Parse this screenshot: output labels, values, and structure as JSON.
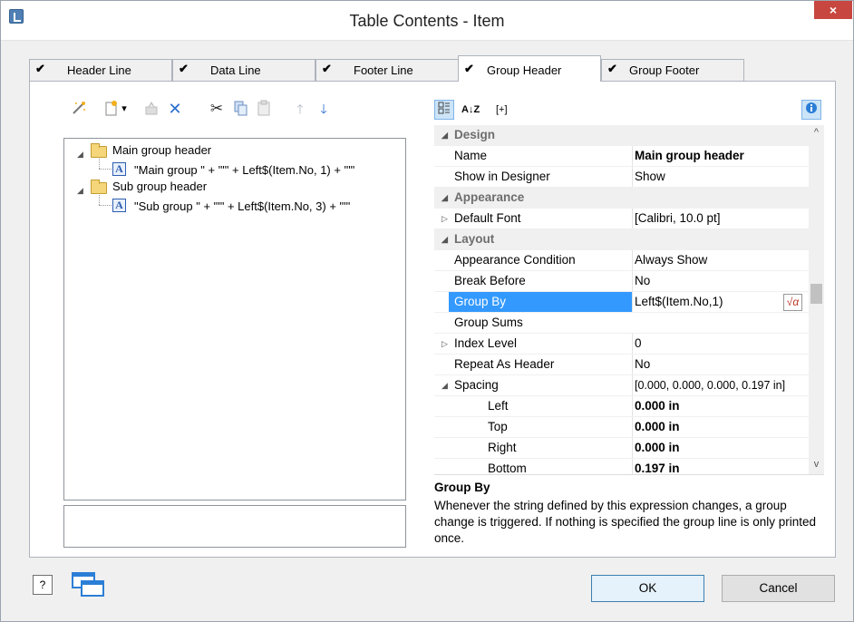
{
  "window": {
    "title": "Table Contents - Item",
    "close_label": "×"
  },
  "tabs": [
    {
      "label": "Header Line",
      "checked": "✔"
    },
    {
      "label": "Data Line",
      "checked": "✔"
    },
    {
      "label": "Footer Line",
      "checked": "✔"
    },
    {
      "label": "Group Header",
      "checked": "✔"
    },
    {
      "label": "Group Footer",
      "checked": "✔"
    }
  ],
  "left_toolbar": {
    "icons": [
      "wand-icon",
      "new-item-icon",
      "dropdown-arrow-icon",
      "properties-icon",
      "delete-icon",
      "cut-icon",
      "copy-icon",
      "paste-icon",
      "move-up-icon",
      "move-down-icon"
    ],
    "delete_glyph": "✕",
    "cut_glyph": "✂",
    "up_glyph": "🡑",
    "down_glyph": "🡓",
    "dropdown_glyph": "▾"
  },
  "tree": {
    "nodes": [
      {
        "label": "Main group header",
        "child": "\"Main group \" + \"'\" + Left$(Item.No, 1) + \"'\""
      },
      {
        "label": "Sub group header",
        "child": "\"Sub group \" + \"'\" + Left$(Item.No, 3) + \"'\""
      }
    ]
  },
  "right_toolbar": {
    "categorized_icon": "categorized-icon",
    "sort_icon": "sort-az-icon",
    "sort_label": "A↓Z",
    "expand_label": "[+]",
    "info_icon": "info-icon"
  },
  "properties": {
    "design_label": "Design",
    "name_label": "Name",
    "name_value": "Main group header",
    "show_in_designer_label": "Show in Designer",
    "show_in_designer_value": "Show",
    "appearance_label": "Appearance",
    "default_font_label": "Default Font",
    "default_font_value": "[Calibri, 10.0 pt]",
    "layout_label": "Layout",
    "appearance_condition_label": "Appearance Condition",
    "appearance_condition_value": "Always Show",
    "break_before_label": "Break Before",
    "break_before_value": "No",
    "group_by_label": "Group By",
    "group_by_value": "Left$(Item.No,1)",
    "group_sums_label": "Group Sums",
    "group_sums_value": "",
    "index_level_label": "Index Level",
    "index_level_value": "0",
    "repeat_as_header_label": "Repeat As Header",
    "repeat_as_header_value": "No",
    "spacing_label": "Spacing",
    "spacing_value": "[0.000, 0.000, 0.000, 0.197 in]",
    "left_label": "Left",
    "left_value": "0.000 in",
    "top_label": "Top",
    "top_value": "0.000 in",
    "right_label": "Right",
    "right_value": "0.000 in",
    "bottom_label": "Bottom",
    "bottom_value": "0.197 in",
    "formula_label": "√α"
  },
  "help": {
    "title": "Group By",
    "text": "Whenever the string defined by this expression changes, a group change is triggered. If nothing is specified the group line is only printed once."
  },
  "buttons": {
    "help_label": "?",
    "ok_label": "OK",
    "cancel_label": "Cancel"
  },
  "colors": {
    "selection": "#3399ff",
    "accent": "#2b7ed6"
  }
}
